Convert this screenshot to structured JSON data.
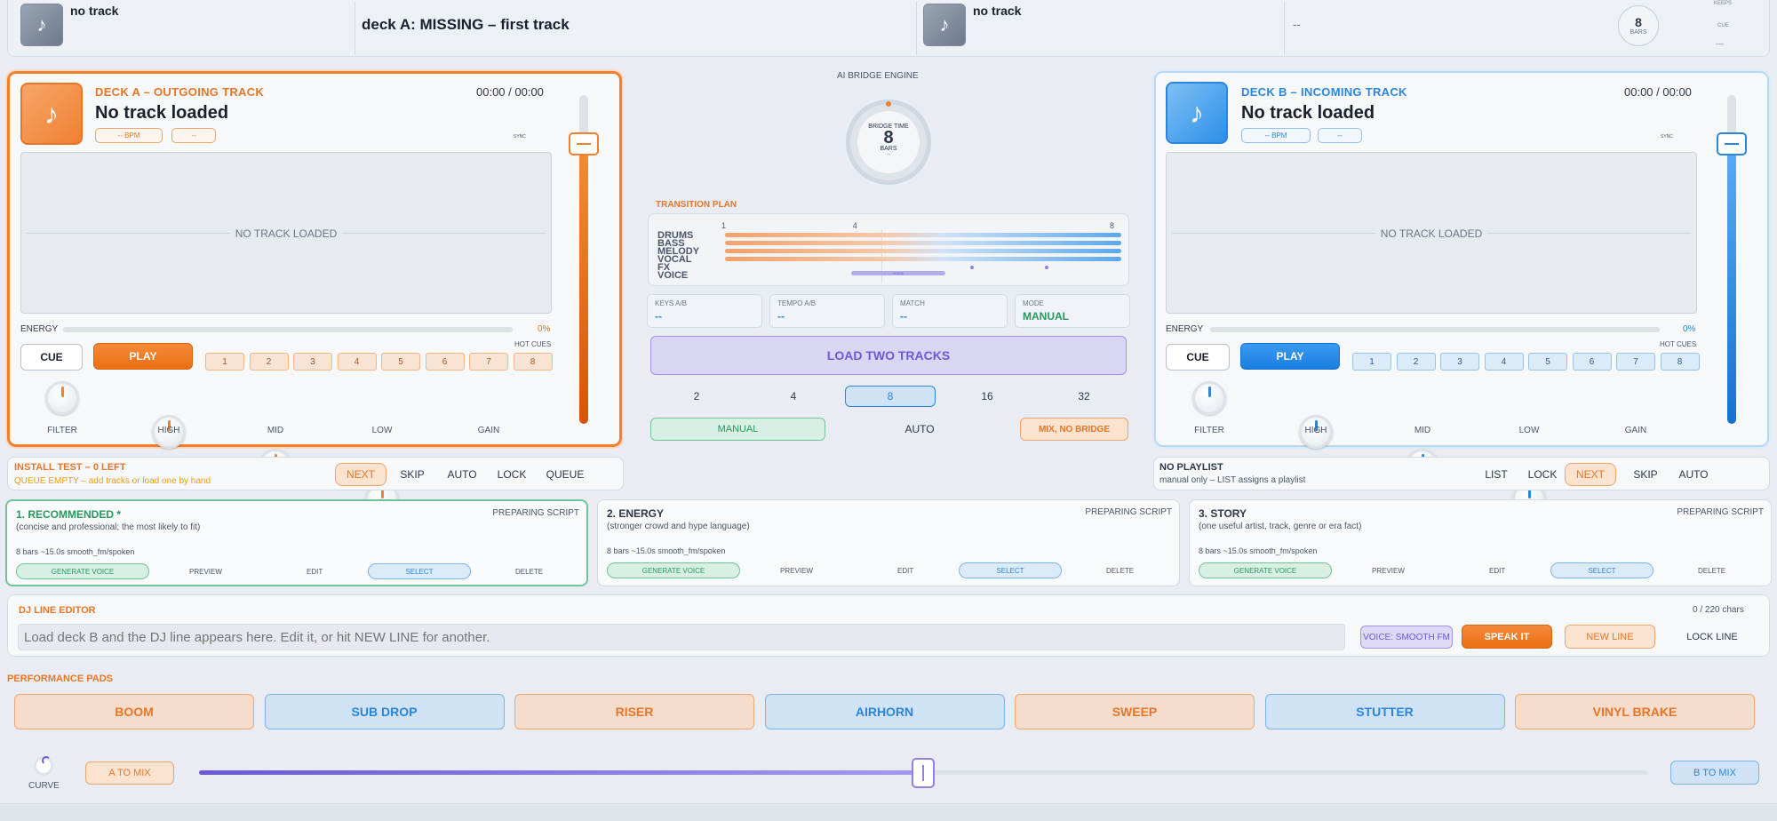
{
  "topbar": {
    "deck_a_status": "no track",
    "main_status": "deck A: MISSING – first track",
    "deck_b_status": "no track",
    "next_status": "--",
    "bars_value": "8",
    "bars_label": "BARS",
    "keys_label": "KEEPS",
    "cue_label": "CUE",
    "dash": "—"
  },
  "deck_a": {
    "label": "DECK A  –  OUTGOING TRACK",
    "time": "00:00 / 00:00",
    "title": "No track loaded",
    "bpm": "-- BPM",
    "key": "--",
    "sync": "SYNC",
    "waveform_empty": "NO TRACK LOADED",
    "energy_label": "ENERGY",
    "energy_value": "0%",
    "energy_level": 0,
    "hot_cues_label": "HOT CUES",
    "cue_label": "CUE",
    "play_label": "PLAY",
    "hot_cues": [
      "1",
      "2",
      "3",
      "4",
      "5",
      "6",
      "7",
      "8"
    ],
    "knobs": [
      "FILTER",
      "HIGH",
      "MID",
      "LOW",
      "GAIN"
    ],
    "accent": "#f08030"
  },
  "deck_b": {
    "label": "DECK B  –  INCOMING TRACK",
    "time": "00:00 / 00:00",
    "title": "No track loaded",
    "bpm": "-- BPM",
    "key": "--",
    "sync": "SYNC",
    "waveform_empty": "NO TRACK LOADED",
    "energy_label": "ENERGY",
    "energy_value": "0%",
    "energy_level": 0,
    "hot_cues_label": "HOT CUES",
    "cue_label": "CUE",
    "play_label": "PLAY",
    "hot_cues": [
      "1",
      "2",
      "3",
      "4",
      "5",
      "6",
      "7",
      "8"
    ],
    "knobs": [
      "FILTER",
      "HIGH",
      "MID",
      "LOW",
      "GAIN"
    ],
    "accent": "#2b86db"
  },
  "bridge": {
    "engine_label": "AI BRIDGE ENGINE",
    "dial_top": "BRIDGE TIME",
    "dial_value": "8",
    "dial_unit": "BARS",
    "dial_sub": "--",
    "plan_label": "TRANSITION PLAN",
    "plan_ticks": [
      "1",
      "4",
      "8"
    ],
    "lanes": [
      "DRUMS",
      "BASS",
      "MELODY",
      "VOCAL",
      "FX",
      "VOICE"
    ],
    "voice_marker": "VOICE",
    "stats": [
      {
        "label": "KEYS A/B",
        "value": "--"
      },
      {
        "label": "TEMPO A/B",
        "value": "--"
      },
      {
        "label": "MATCH",
        "value": "--"
      },
      {
        "label": "MODE",
        "value": "MANUAL"
      }
    ],
    "load_label": "LOAD TWO TRACKS",
    "bar_options": [
      "2",
      "4",
      "8",
      "16",
      "32"
    ],
    "selected_bars": "8",
    "mode_manual": "MANUAL",
    "mode_auto": "AUTO",
    "mode_mix": "MIX, NO BRIDGE"
  },
  "queue_a": {
    "title": "INSTALL TEST  –  0 LEFT",
    "subtitle": "QUEUE EMPTY – add tracks or load one by hand",
    "buttons": [
      "NEXT",
      "SKIP",
      "AUTO",
      "LOCK",
      "QUEUE"
    ]
  },
  "queue_b": {
    "title": "NO PLAYLIST",
    "subtitle": "manual only – LIST assigns a playlist",
    "buttons": [
      "LIST",
      "LOCK",
      "NEXT",
      "SKIP",
      "AUTO"
    ]
  },
  "scripts": [
    {
      "title": "1.  RECOMMENDED  *",
      "desc": "(concise and professional; the most likely to fit)",
      "status": "PREPARING SCRIPT",
      "meta": "8 bars  ~15.0s   smooth_fm/spoken",
      "gen": "GENERATE VOICE",
      "preview": "PREVIEW",
      "edit": "EDIT",
      "select": "SELECT",
      "delete": "DELETE"
    },
    {
      "title": "2.  ENERGY",
      "desc": "(stronger crowd and hype language)",
      "status": "PREPARING SCRIPT",
      "meta": "8 bars  ~15.0s   smooth_fm/spoken",
      "gen": "GENERATE VOICE",
      "preview": "PREVIEW",
      "edit": "EDIT",
      "select": "SELECT",
      "delete": "DELETE"
    },
    {
      "title": "3.  STORY",
      "desc": "(one useful artist, track, genre or era fact)",
      "status": "PREPARING SCRIPT",
      "meta": "8 bars  ~15.0s   smooth_fm/spoken",
      "gen": "GENERATE VOICE",
      "preview": "PREVIEW",
      "edit": "EDIT",
      "select": "SELECT",
      "delete": "DELETE"
    }
  ],
  "editor": {
    "label": "DJ LINE EDITOR",
    "counter": "0 / 220 chars",
    "placeholder": "Load deck B and the DJ line appears here. Edit it, or hit NEW LINE for another.",
    "voice": "VOICE: SMOOTH FM",
    "speak": "SPEAK IT",
    "new_line": "NEW LINE",
    "lock_line": "LOCK LINE"
  },
  "pads": {
    "label": "PERFORMANCE PADS",
    "items": [
      "BOOM",
      "SUB DROP",
      "RISER",
      "AIRHORN",
      "SWEEP",
      "STUTTER",
      "VINYL BRAKE"
    ]
  },
  "crossfader": {
    "curve_label": "CURVE",
    "a_label": "A TO MIX",
    "b_label": "B TO MIX",
    "position": 0.5
  }
}
